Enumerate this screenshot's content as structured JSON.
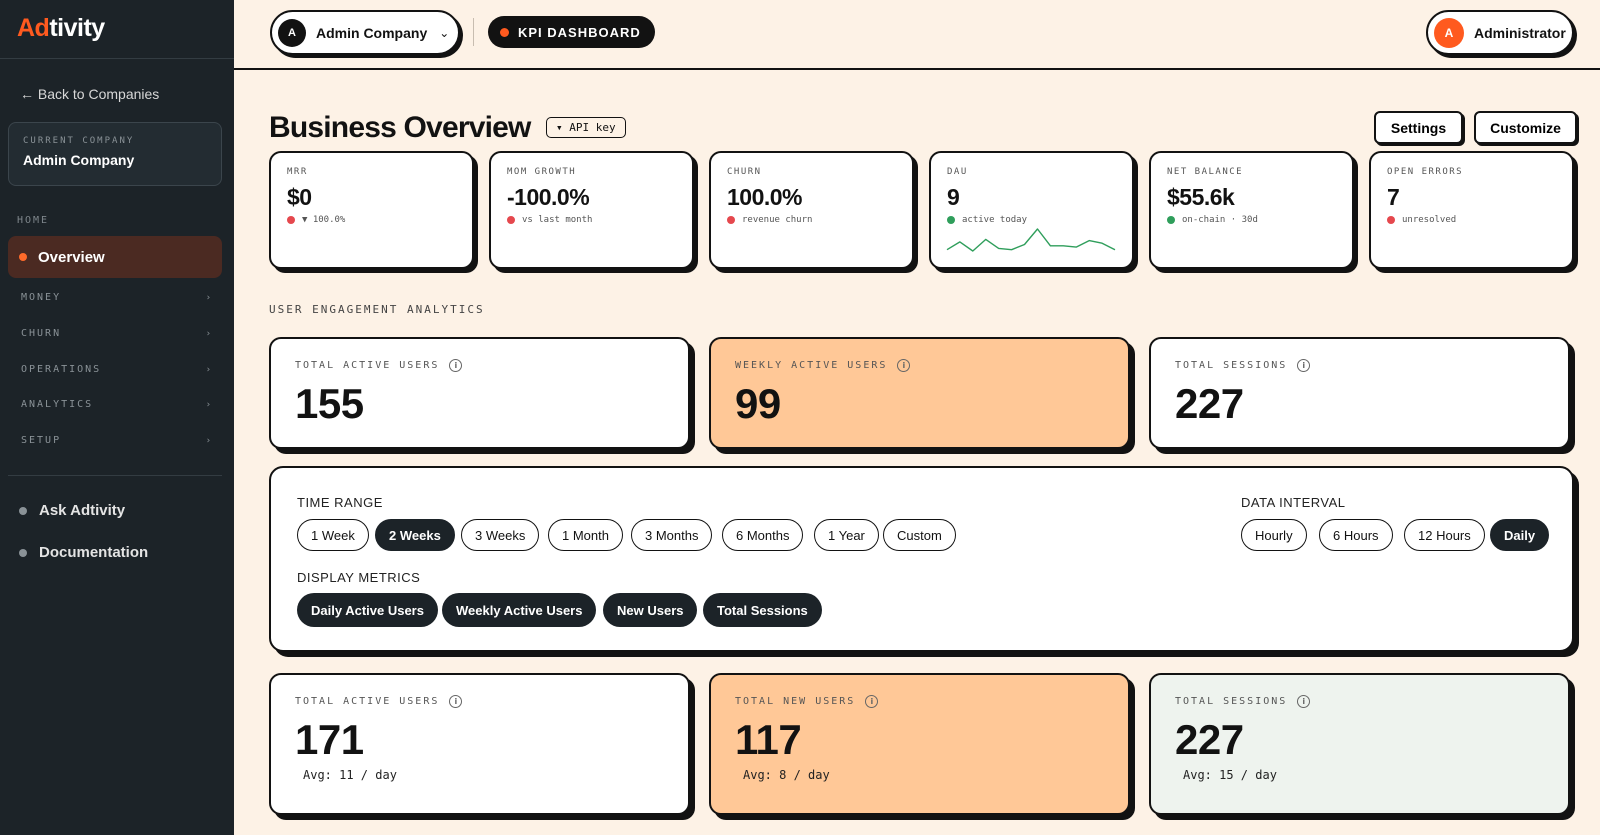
{
  "app": {
    "logo_a": "Ad",
    "logo_b": "tivity"
  },
  "sidebar": {
    "back": "← Back to Companies",
    "current_company_label": "CURRENT COMPANY",
    "current_company": "Admin Company",
    "home_label": "HOME",
    "overview": "Overview",
    "groups": [
      "MONEY",
      "CHURN",
      "OPERATIONS",
      "ANALYTICS",
      "SETUP"
    ],
    "chevron": "›",
    "links": [
      "Ask Adtivity",
      "Documentation"
    ]
  },
  "topbar": {
    "company_initial": "A",
    "company": "Admin Company",
    "company_chevron": "⌄",
    "kpi": "KPI DASHBOARD",
    "user_initial": "A",
    "user": "Administrator"
  },
  "header": {
    "title": "Business Overview",
    "api_key": "▾ API key",
    "settings": "Settings",
    "customize": "Customize"
  },
  "colors": {
    "accent": "#ff5a1f",
    "red": "#e5484d",
    "green": "#2f9e5b",
    "orange_card": "#ffc897",
    "dark": "#1c2328"
  },
  "kpis": [
    {
      "label": "MRR",
      "value": "$0",
      "sub": "▼ 100.0%",
      "dot": "#e5484d"
    },
    {
      "label": "MOM GROWTH",
      "value": "-100.0%",
      "sub": "vs last month",
      "dot": "#e5484d"
    },
    {
      "label": "CHURN",
      "value": "100.0%",
      "sub": "revenue churn",
      "dot": "#e5484d"
    },
    {
      "label": "DAU",
      "value": "9",
      "sub": "active today",
      "dot": "#2f9e5b"
    },
    {
      "label": "NET BALANCE",
      "value": "$55.6k",
      "sub": "on-chain · 30d",
      "dot": "#2f9e5b"
    },
    {
      "label": "OPEN ERRORS",
      "value": "7",
      "sub": "unresolved",
      "dot": "#e5484d"
    }
  ],
  "dau_sparkline": [
    3,
    9,
    2,
    11,
    4,
    3,
    7,
    19,
    6,
    6,
    5,
    10,
    8,
    3
  ],
  "engagement": {
    "section_label": "USER ENGAGEMENT ANALYTICS",
    "top": [
      {
        "label": "TOTAL ACTIVE USERS",
        "value": "155"
      },
      {
        "label": "WEEKLY ACTIVE USERS",
        "value": "99"
      },
      {
        "label": "TOTAL SESSIONS",
        "value": "227"
      }
    ],
    "bottom": [
      {
        "label": "TOTAL ACTIVE USERS",
        "value": "171",
        "avg": "Avg: 11 / day"
      },
      {
        "label": "TOTAL NEW USERS",
        "value": "117",
        "avg": "Avg: 8 / day"
      },
      {
        "label": "TOTAL SESSIONS",
        "value": "227",
        "avg": "Avg: 15 / day"
      }
    ],
    "info_glyph": "i"
  },
  "filters": {
    "time_range_label": "TIME RANGE",
    "time_ranges": [
      "1 Week",
      "2 Weeks",
      "3 Weeks",
      "1 Month",
      "3 Months",
      "6 Months",
      "1 Year",
      "Custom"
    ],
    "time_selected": "2 Weeks",
    "interval_label": "DATA INTERVAL",
    "intervals": [
      "Hourly",
      "6 Hours",
      "12 Hours",
      "Daily"
    ],
    "interval_selected": "Daily",
    "metrics_label": "DISPLAY METRICS",
    "metrics": [
      "Daily Active Users",
      "Weekly Active Users",
      "New Users",
      "Total Sessions"
    ]
  }
}
